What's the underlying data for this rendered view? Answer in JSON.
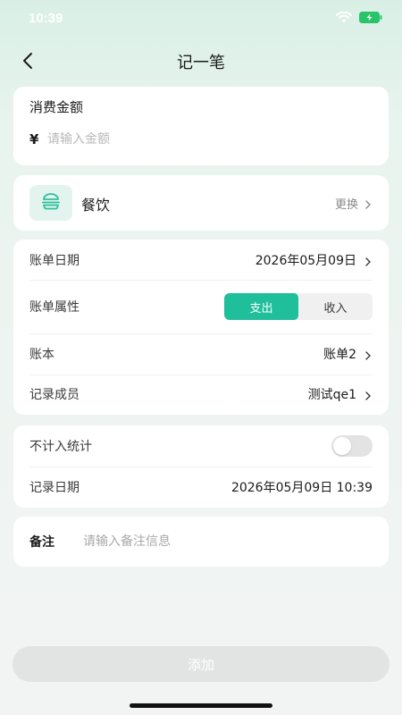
{
  "status_bar": {
    "time": "10:39"
  },
  "nav": {
    "title": "记一笔"
  },
  "amount": {
    "label": "消费金额",
    "currency": "¥",
    "placeholder": "请输入金额"
  },
  "category": {
    "name": "餐饮",
    "change_label": "更换",
    "icon": "burger-icon"
  },
  "details": {
    "bill_date_label": "账单日期",
    "bill_date_value": "2026年05月09日",
    "attribute_label": "账单属性",
    "attribute_options": [
      "支出",
      "收入"
    ],
    "attribute_selected": "支出",
    "ledger_label": "账本",
    "ledger_value": "账单2",
    "member_label": "记录成员",
    "member_value": "测试qe1"
  },
  "stats": {
    "exclude_label": "不计入统计",
    "exclude_enabled": false,
    "record_date_label": "记录日期",
    "record_date_value": "2026年05月09日 10:39"
  },
  "note": {
    "label": "备注",
    "placeholder": "请输入备注信息"
  },
  "submit": {
    "label": "添加"
  },
  "colors": {
    "accent": "#1fbf9c",
    "icon_bg": "#e3f4ef",
    "disabled_button": "#e2e4e3"
  }
}
